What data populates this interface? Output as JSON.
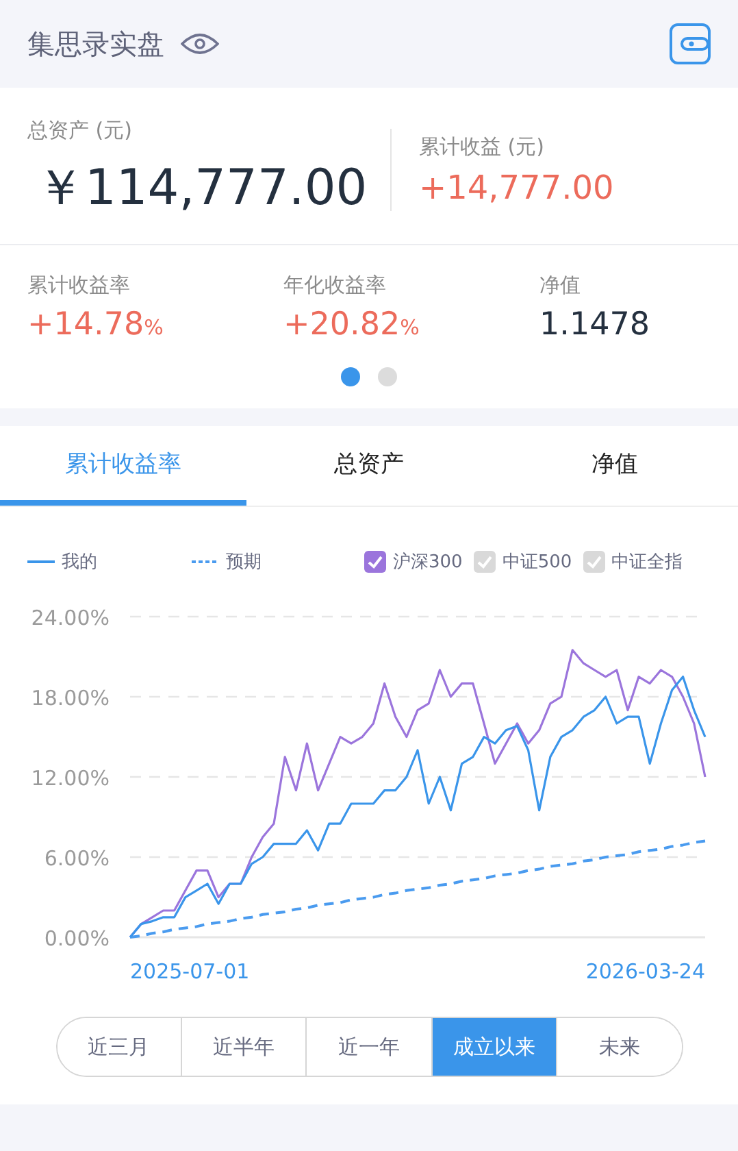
{
  "header": {
    "title": "集思录实盘"
  },
  "summary": {
    "total_label": "总资产 (元)",
    "total_value": "￥114,777.00",
    "profit_label": "累计收益 (元)",
    "profit_value": "+14,777.00"
  },
  "stats": [
    {
      "label": "累计收益率",
      "value": "+14.78",
      "unit": "%",
      "kind": "change"
    },
    {
      "label": "年化收益率",
      "value": "+20.82",
      "unit": "%",
      "kind": "change"
    },
    {
      "label": "净值",
      "value": "1.1478",
      "kind": "plain"
    }
  ],
  "pager": [
    {
      "selected": true
    },
    {
      "selected": false
    }
  ],
  "tabs": [
    {
      "label": "累计收益率",
      "selected": true
    },
    {
      "label": "总资产",
      "selected": false
    },
    {
      "label": "净值",
      "selected": false
    }
  ],
  "legend": [
    {
      "kind": "series"
    },
    {
      "kind": "series"
    },
    {
      "kind": "checkbox",
      "checked": true
    },
    {
      "kind": "checkbox",
      "label": "中证500",
      "checked": false
    },
    {
      "kind": "checkbox",
      "label": "中证全指",
      "checked": false
    }
  ],
  "axis_dates": [
    "2025-07-01",
    "2026-03-24"
  ],
  "chart_data": {
    "type": "line",
    "ylim": [
      0,
      24
    ],
    "grid": true,
    "yticks": [
      {
        "value": 0,
        "label": "0.00%"
      },
      {
        "value": 6,
        "label": "6.00%"
      },
      {
        "value": 12,
        "label": "12.00%"
      },
      {
        "value": 18,
        "label": "18.00%"
      },
      {
        "value": 24,
        "label": "24.00%"
      }
    ],
    "series": [
      {
        "name": "我的",
        "color": "#3a95ea",
        "values": [
          0,
          1,
          1.2,
          1.5,
          1.5,
          3,
          3.5,
          4,
          2.5,
          4,
          4,
          5.5,
          6,
          7,
          7,
          7,
          8,
          6.5,
          8.5,
          8.5,
          10,
          10,
          10,
          11,
          11,
          12,
          14,
          10,
          12,
          9.5,
          13,
          13.5,
          15,
          14.5,
          15.5,
          15.8,
          14,
          9.5,
          13.5,
          15,
          15.5,
          16.5,
          17,
          18,
          16,
          16.5,
          16.5,
          13,
          16,
          18.5,
          19.5,
          17,
          15
        ]
      },
      {
        "name": "预期",
        "color": "#4a9bef",
        "line_style": "dashed",
        "values": [
          0,
          0.1,
          0.3,
          0.4,
          0.6,
          0.7,
          0.8,
          1,
          1.1,
          1.2,
          1.4,
          1.5,
          1.7,
          1.8,
          1.9,
          2.1,
          2.2,
          2.4,
          2.5,
          2.6,
          2.8,
          2.9,
          3,
          3.2,
          3.3,
          3.5,
          3.6,
          3.7,
          3.9,
          4,
          4.2,
          4.3,
          4.4,
          4.6,
          4.7,
          4.8,
          5,
          5.1,
          5.3,
          5.4,
          5.5,
          5.7,
          5.8,
          6,
          6.1,
          6.2,
          6.4,
          6.5,
          6.6,
          6.8,
          6.9,
          7.1,
          7.2
        ]
      },
      {
        "name": "沪深300",
        "color": "#9b75dc",
        "values": [
          0,
          1,
          1.5,
          2,
          2,
          3.5,
          5,
          5,
          3,
          4,
          4,
          6,
          7.5,
          8.5,
          13.5,
          11,
          14.5,
          11,
          13,
          15,
          14.5,
          15,
          16,
          19,
          16.5,
          15,
          17,
          17.5,
          20,
          18,
          19,
          19,
          16,
          13,
          14.5,
          16,
          14.5,
          15.5,
          17.5,
          18,
          21.5,
          20.5,
          20,
          19.5,
          20,
          17,
          19.5,
          19,
          20,
          19.5,
          18,
          16,
          12
        ]
      }
    ]
  },
  "periods": [
    {
      "label": "近三月",
      "selected": false
    },
    {
      "label": "近半年",
      "selected": false
    },
    {
      "label": "近一年",
      "selected": false
    },
    {
      "label": "成立以来",
      "selected": true
    },
    {
      "label": "未来",
      "selected": false
    }
  ]
}
